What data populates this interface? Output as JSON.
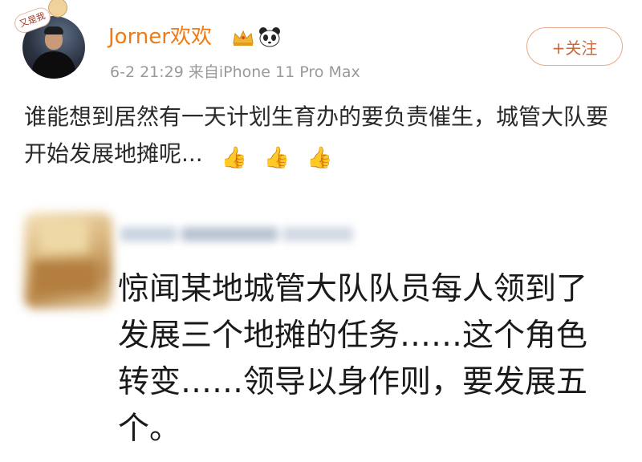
{
  "post": {
    "avatar_sticker": "又是我",
    "username": "Jorner欢欢",
    "meta": "6-2 21:29  来自iPhone 11 Pro Max",
    "follow_label": "+关注",
    "text": "谁能想到居然有一天计划生育办的要负责催生，城管大队要开始发展地摊呢...",
    "emoji": [
      "👍",
      "👍",
      "👍"
    ]
  },
  "quoted": {
    "text": "惊闻某地城管大队队员每人领到了发展三个地摊的任务……这个角色转变……领导以身作则，要发展五个。"
  },
  "colors": {
    "username": "#f07a15",
    "meta": "#9a9a9a",
    "follow_border": "#e8a88a",
    "body_text": "#2a2a2a"
  }
}
